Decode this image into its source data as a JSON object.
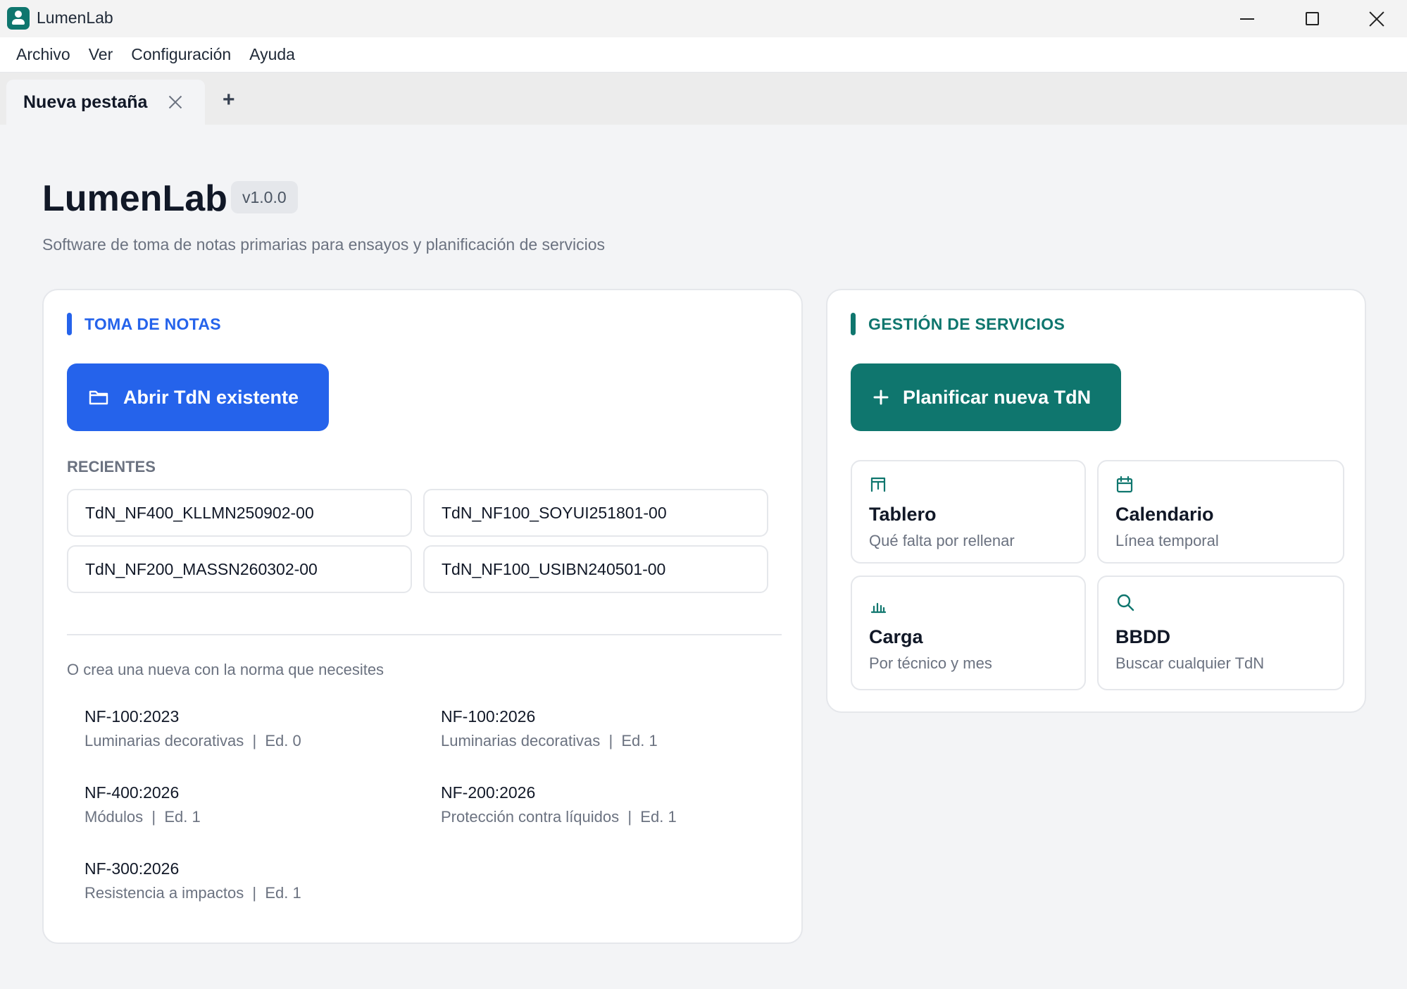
{
  "window": {
    "title": "LumenLab"
  },
  "menu": [
    "Archivo",
    "Ver",
    "Configuración",
    "Ayuda"
  ],
  "tabs": [
    {
      "label": "Nueva pestaña"
    }
  ],
  "tab_add_label": "+",
  "header": {
    "title": "LumenLab",
    "version": "v1.0.0",
    "subtitle": "Software de toma de notas primarias para ensayos y planificación de servicios"
  },
  "notes": {
    "section_title": "TOMA DE NOTAS",
    "open_button": "Abrir TdN existente",
    "recent_label": "RECIENTES",
    "recent": [
      "TdN_NF400_KLLMN250902-00",
      "TdN_NF100_SOYUI251801-00",
      "TdN_NF200_MASSN260302-00",
      "TdN_NF100_USIBN240501-00"
    ],
    "create_hint": "O crea una nueva con la norma que necesites",
    "norms": [
      {
        "code": "NF-100:2023",
        "desc": "Luminarias decorativas  |  Ed. 0"
      },
      {
        "code": "NF-100:2026",
        "desc": "Luminarias decorativas  |  Ed. 1"
      },
      {
        "code": "NF-400:2026",
        "desc": "Módulos  |  Ed. 1"
      },
      {
        "code": "NF-200:2026",
        "desc": "Protección contra líquidos  |  Ed. 1"
      },
      {
        "code": "NF-300:2026",
        "desc": "Resistencia a impactos  |  Ed. 1"
      }
    ]
  },
  "services": {
    "section_title": "GESTIÓN DE SERVICIOS",
    "plan_button": "Planificar nueva TdN",
    "tiles": [
      {
        "title": "Tablero",
        "subtitle": "Qué falta por rellenar",
        "icon": "board-icon"
      },
      {
        "title": "Calendario",
        "subtitle": "Línea temporal",
        "icon": "calendar-icon"
      },
      {
        "title": "Carga",
        "subtitle": "Por técnico y mes",
        "icon": "bar-chart-icon"
      },
      {
        "title": "BBDD",
        "subtitle": "Buscar cualquier TdN",
        "icon": "search-icon"
      }
    ]
  },
  "colors": {
    "notes_accent": "#2563eb",
    "services_accent": "#0f766e"
  }
}
